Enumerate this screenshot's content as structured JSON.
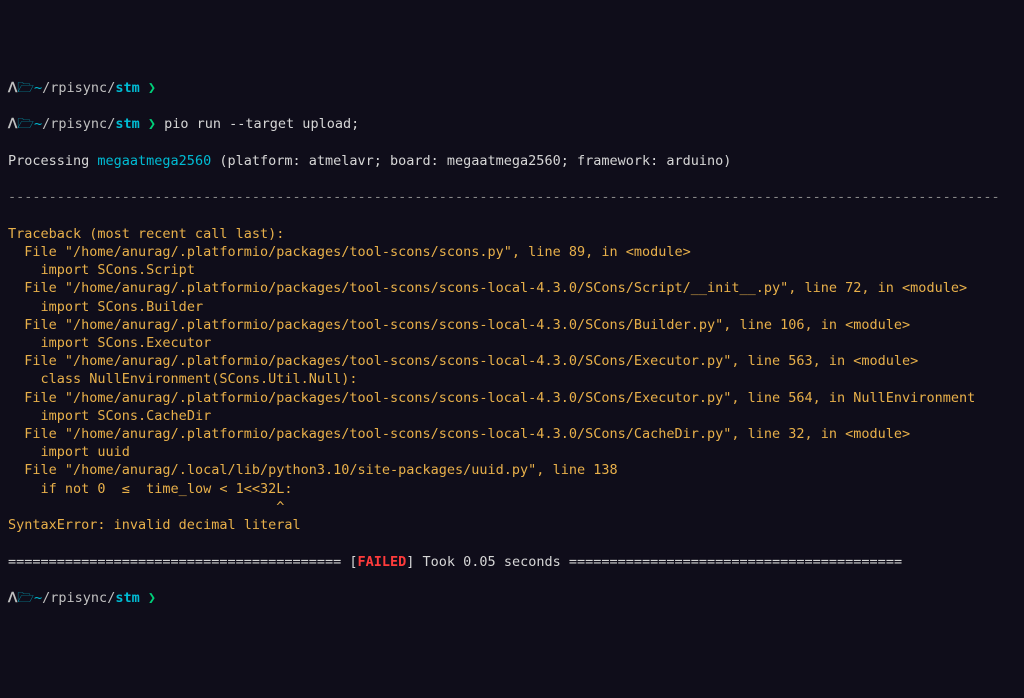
{
  "prompt": {
    "home_glyph": "ᐱ",
    "folder_glyph": "🗁",
    "tilde": "~",
    "slash": "/",
    "parent_dir": "rpisync",
    "current_dir": "stm",
    "arrow": "❯"
  },
  "command": "pio run --target upload;",
  "processing": {
    "prefix": "Processing ",
    "board": "megaatmega2560",
    "details": " (platform: atmelavr; board: megaatmega2560; framework: arduino)"
  },
  "separator_top": "--------------------------------------------------------------------------------------------------------------------------",
  "traceback": [
    "Traceback (most recent call last):",
    "  File \"/home/anurag/.platformio/packages/tool-scons/scons.py\", line 89, in <module>",
    "    import SCons.Script",
    "  File \"/home/anurag/.platformio/packages/tool-scons/scons-local-4.3.0/SCons/Script/__init__.py\", line 72, in <module>",
    "    import SCons.Builder",
    "  File \"/home/anurag/.platformio/packages/tool-scons/scons-local-4.3.0/SCons/Builder.py\", line 106, in <module>",
    "    import SCons.Executor",
    "  File \"/home/anurag/.platformio/packages/tool-scons/scons-local-4.3.0/SCons/Executor.py\", line 563, in <module>",
    "    class NullEnvironment(SCons.Util.Null):",
    "  File \"/home/anurag/.platformio/packages/tool-scons/scons-local-4.3.0/SCons/Executor.py\", line 564, in NullEnvironment",
    "    import SCons.CacheDir",
    "  File \"/home/anurag/.platformio/packages/tool-scons/scons-local-4.3.0/SCons/CacheDir.py\", line 32, in <module>",
    "    import uuid",
    "  File \"/home/anurag/.local/lib/python3.10/site-packages/uuid.py\", line 138",
    "    if not 0  ≤  time_low < 1<<32L:",
    "                                 ^",
    "SyntaxError: invalid decimal literal"
  ],
  "status_line": {
    "equals_left": "========================================= [",
    "failed": "FAILED",
    "rest": "] Took 0.05 seconds ========================================="
  }
}
